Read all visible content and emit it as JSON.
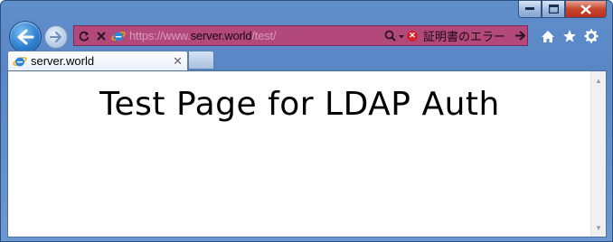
{
  "address_bar": {
    "url_scheme": "https://www.",
    "url_domain": "server.world",
    "url_path": "/test/",
    "certificate_error": "証明書のエラー"
  },
  "tabs": [
    {
      "label": "server.world"
    }
  ],
  "page": {
    "heading": "Test Page for LDAP Auth"
  },
  "icons": {
    "back": "back-arrow-icon",
    "forward": "forward-arrow-icon",
    "refresh": "refresh-icon",
    "stop": "stop-icon",
    "site": "ie-logo-icon",
    "search": "search-icon",
    "cert_error": "error-icon",
    "go": "go-arrow-icon",
    "home": "home-icon",
    "favorites": "star-icon",
    "tools": "gear-icon"
  },
  "colors": {
    "address_bar_error": "#b2497a",
    "frame": "#5f8fcb",
    "cert_error": "#d2232a"
  }
}
